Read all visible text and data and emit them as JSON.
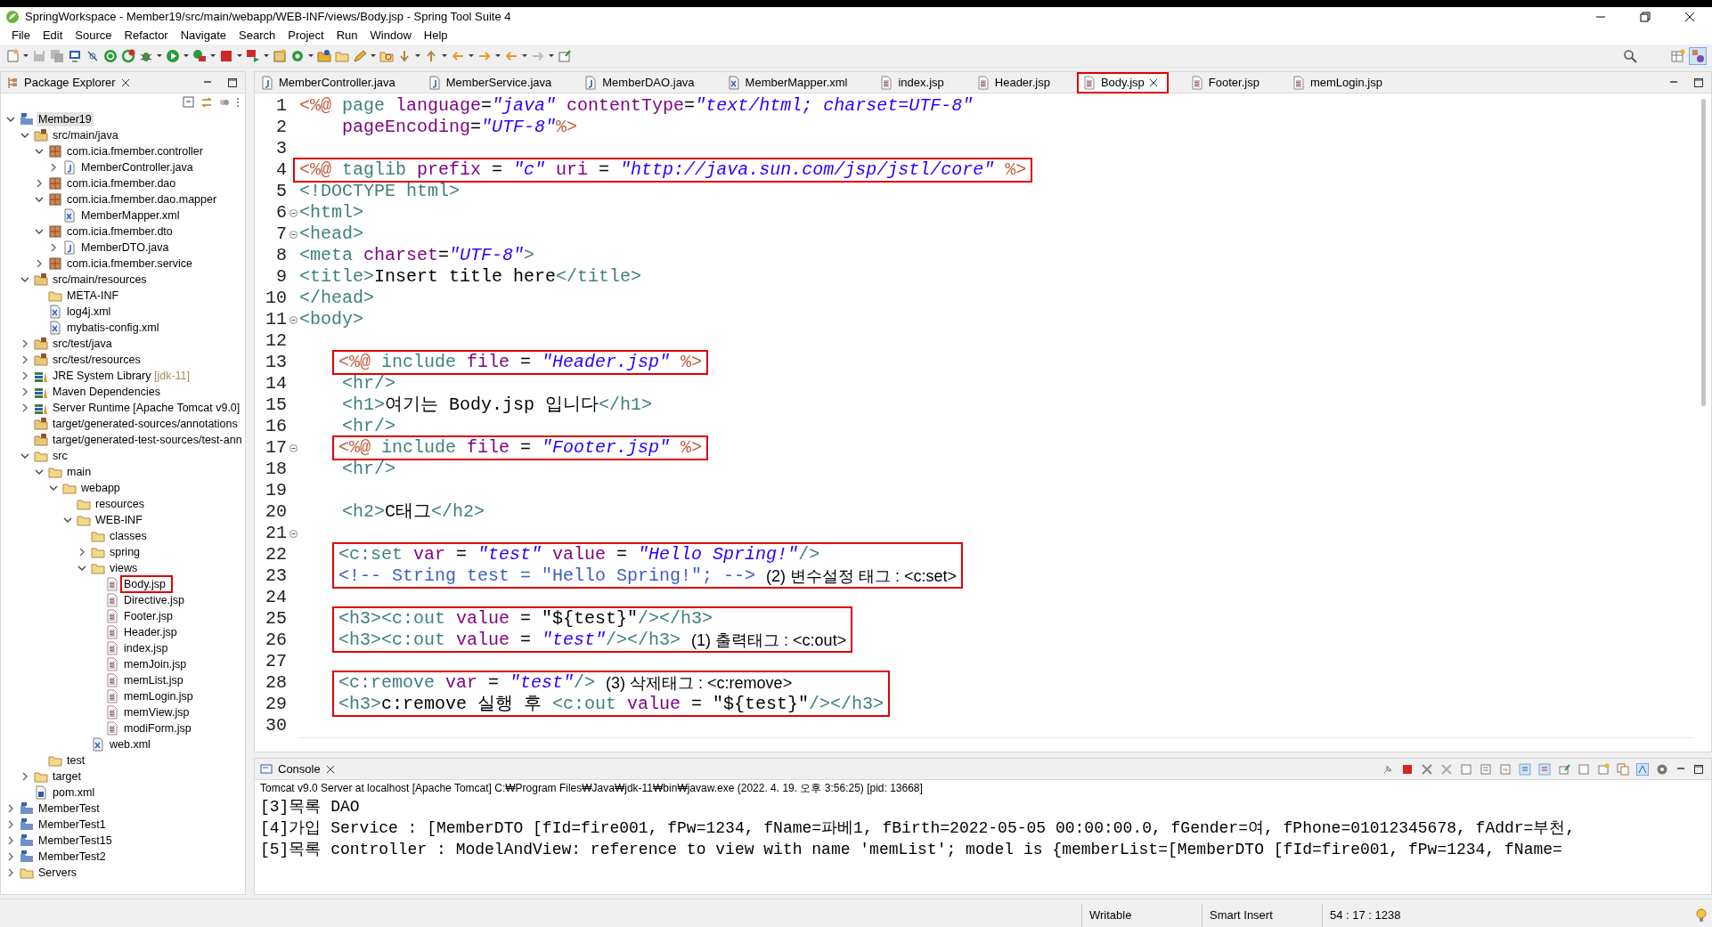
{
  "window": {
    "title": "SpringWorkspace - Member19/src/main/webapp/WEB-INF/views/Body.jsp - Spring Tool Suite 4"
  },
  "menu": [
    "File",
    "Edit",
    "Source",
    "Refactor",
    "Navigate",
    "Search",
    "Project",
    "Run",
    "Window",
    "Help"
  ],
  "package_explorer": {
    "title": "Package Explorer",
    "tree": [
      {
        "label": "Member19",
        "kind": "project",
        "expanded": true,
        "selected": true,
        "annotated": false,
        "children": [
          {
            "label": "src/main/java",
            "kind": "srcfolder",
            "expanded": true,
            "selected": false,
            "annotated": false,
            "children": [
              {
                "label": "com.icia.fmember.controller",
                "kind": "package",
                "expanded": true,
                "selected": false,
                "annotated": false,
                "children": [
                  {
                    "label": "MemberController.java",
                    "kind": "java",
                    "expanded": false,
                    "selected": false,
                    "annotated": false
                  }
                ]
              },
              {
                "label": "com.icia.fmember.dao",
                "kind": "package",
                "expanded": false,
                "selected": false,
                "annotated": false
              },
              {
                "label": "com.icia.fmember.dao.mapper",
                "kind": "package",
                "expanded": true,
                "selected": false,
                "annotated": false,
                "children": [
                  {
                    "label": "MemberMapper.xml",
                    "kind": "xml",
                    "selected": false,
                    "annotated": false
                  }
                ]
              },
              {
                "label": "com.icia.fmember.dto",
                "kind": "package",
                "expanded": true,
                "selected": false,
                "annotated": false,
                "children": [
                  {
                    "label": "MemberDTO.java",
                    "kind": "java",
                    "expanded": false,
                    "selected": false,
                    "annotated": false
                  }
                ]
              },
              {
                "label": "com.icia.fmember.service",
                "kind": "package",
                "expanded": false,
                "selected": false,
                "annotated": false
              }
            ]
          },
          {
            "label": "src/main/resources",
            "kind": "srcfolder",
            "expanded": true,
            "selected": false,
            "annotated": false,
            "children": [
              {
                "label": "META-INF",
                "kind": "folder",
                "selected": false,
                "annotated": false
              },
              {
                "label": "log4j.xml",
                "kind": "xml",
                "selected": false,
                "annotated": false
              },
              {
                "label": "mybatis-config.xml",
                "kind": "xml",
                "selected": false,
                "annotated": false
              }
            ]
          },
          {
            "label": "src/test/java",
            "kind": "srcfolder",
            "expanded": false,
            "selected": false,
            "annotated": false
          },
          {
            "label": "src/test/resources",
            "kind": "srcfolder",
            "expanded": false,
            "selected": false,
            "annotated": false
          },
          {
            "label": "JRE System Library",
            "decoration": "[jdk-11]",
            "kind": "library",
            "expanded": false,
            "selected": false,
            "annotated": false
          },
          {
            "label": "Maven Dependencies",
            "kind": "library",
            "expanded": false,
            "selected": false,
            "annotated": false
          },
          {
            "label": "Server Runtime [Apache Tomcat v9.0]",
            "kind": "library",
            "expanded": false,
            "selected": false,
            "annotated": false
          },
          {
            "label": "target/generated-sources/annotations",
            "kind": "srcfolder",
            "selected": false,
            "annotated": false
          },
          {
            "label": "target/generated-test-sources/test-ann",
            "kind": "srcfolder",
            "selected": false,
            "annotated": false
          },
          {
            "label": "src",
            "kind": "folder",
            "expanded": true,
            "selected": false,
            "annotated": false,
            "children": [
              {
                "label": "main",
                "kind": "folder",
                "expanded": true,
                "selected": false,
                "annotated": false,
                "children": [
                  {
                    "label": "webapp",
                    "kind": "folder",
                    "expanded": true,
                    "selected": false,
                    "annotated": false,
                    "children": [
                      {
                        "label": "resources",
                        "kind": "folder",
                        "selected": false,
                        "annotated": false
                      },
                      {
                        "label": "WEB-INF",
                        "kind": "folder",
                        "expanded": true,
                        "selected": false,
                        "annotated": false,
                        "children": [
                          {
                            "label": "classes",
                            "kind": "folder",
                            "selected": false,
                            "annotated": false
                          },
                          {
                            "label": "spring",
                            "kind": "folder",
                            "expanded": false,
                            "selected": false,
                            "annotated": false
                          },
                          {
                            "label": "views",
                            "kind": "folder",
                            "expanded": true,
                            "selected": false,
                            "annotated": false,
                            "children": [
                              {
                                "label": "Body.jsp",
                                "kind": "jsp",
                                "selected": false,
                                "annotated": true
                              },
                              {
                                "label": "Directive.jsp",
                                "kind": "jsp",
                                "selected": false,
                                "annotated": false
                              },
                              {
                                "label": "Footer.jsp",
                                "kind": "jsp",
                                "selected": false,
                                "annotated": false
                              },
                              {
                                "label": "Header.jsp",
                                "kind": "jsp",
                                "selected": false,
                                "annotated": false
                              },
                              {
                                "label": "index.jsp",
                                "kind": "jsp",
                                "selected": false,
                                "annotated": false
                              },
                              {
                                "label": "memJoin.jsp",
                                "kind": "jsp",
                                "selected": false,
                                "annotated": false
                              },
                              {
                                "label": "memList.jsp",
                                "kind": "jsp",
                                "selected": false,
                                "annotated": false
                              },
                              {
                                "label": "memLogin.jsp",
                                "kind": "jsp",
                                "selected": false,
                                "annotated": false
                              },
                              {
                                "label": "memView.jsp",
                                "kind": "jsp",
                                "selected": false,
                                "annotated": false
                              },
                              {
                                "label": "modiForm.jsp",
                                "kind": "jsp",
                                "selected": false,
                                "annotated": false
                              }
                            ]
                          },
                          {
                            "label": "web.xml",
                            "kind": "xml",
                            "selected": false,
                            "annotated": false
                          }
                        ]
                      }
                    ]
                  }
                ]
              },
              {
                "label": "test",
                "kind": "folder",
                "selected": false,
                "annotated": false
              }
            ]
          },
          {
            "label": "target",
            "kind": "folder",
            "expanded": false,
            "selected": false,
            "annotated": false
          },
          {
            "label": "pom.xml",
            "kind": "pom",
            "selected": false,
            "annotated": false
          }
        ]
      },
      {
        "label": "MemberTest",
        "kind": "project",
        "expanded": false,
        "selected": false,
        "annotated": false
      },
      {
        "label": "MemberTest1",
        "kind": "project",
        "expanded": false,
        "selected": false,
        "annotated": false
      },
      {
        "label": "MemberTest15",
        "kind": "project",
        "expanded": false,
        "selected": false,
        "annotated": false
      },
      {
        "label": "MemberTest2",
        "kind": "project",
        "expanded": false,
        "selected": false,
        "annotated": false
      },
      {
        "label": "Servers",
        "kind": "folder",
        "expanded": false,
        "selected": false,
        "annotated": false
      }
    ]
  },
  "editor": {
    "tabs": [
      {
        "label": "MemberController.java",
        "kind": "java",
        "selected": false,
        "annotated": false
      },
      {
        "label": "MemberService.java",
        "kind": "java",
        "selected": false,
        "annotated": false
      },
      {
        "label": "MemberDAO.java",
        "kind": "java",
        "selected": false,
        "annotated": false
      },
      {
        "label": "MemberMapper.xml",
        "kind": "xml",
        "selected": false,
        "annotated": false
      },
      {
        "label": "index.jsp",
        "kind": "jsp",
        "selected": false,
        "annotated": false
      },
      {
        "label": "Header.jsp",
        "kind": "jsp",
        "selected": false,
        "annotated": false
      },
      {
        "label": "Body.jsp",
        "kind": "jsp",
        "selected": true,
        "annotated": true
      },
      {
        "label": "Footer.jsp",
        "kind": "jsp",
        "selected": false,
        "annotated": false
      },
      {
        "label": "memLogin.jsp",
        "kind": "jsp",
        "selected": false,
        "annotated": false
      }
    ],
    "blocks": [
      {
        "kind": "line",
        "num": "1",
        "foldable": false,
        "tokens": [
          {
            "kind": "d",
            "t": "<%@"
          },
          {
            "kind": "tg",
            "t": " page "
          },
          {
            "kind": "at",
            "t": "language"
          },
          {
            "kind": "tx",
            "t": "="
          },
          {
            "kind": "st",
            "t": "\"java\""
          },
          {
            "kind": "at",
            "t": " contentType"
          },
          {
            "kind": "tx",
            "t": "="
          },
          {
            "kind": "st",
            "t": "\"text/html; charset=UTF-8\""
          }
        ]
      },
      {
        "kind": "line",
        "num": "2",
        "foldable": false,
        "tokens": [
          {
            "kind": "at",
            "t": "    pageEncoding"
          },
          {
            "kind": "tx",
            "t": "="
          },
          {
            "kind": "st",
            "t": "\"UTF-8\""
          },
          {
            "kind": "d",
            "t": "%>"
          }
        ]
      },
      {
        "kind": "line",
        "num": "3",
        "foldable": false
      },
      {
        "kind": "boxed",
        "indented": false,
        "lines": [
          {
            "num": "4",
            "foldable": false,
            "tokens": [
              {
                "kind": "d",
                "t": "<%@"
              },
              {
                "kind": "tg",
                "t": " taglib "
              },
              {
                "kind": "at",
                "t": "prefix"
              },
              {
                "kind": "tx",
                "t": " = "
              },
              {
                "kind": "st",
                "t": "\"c\""
              },
              {
                "kind": "at",
                "t": " uri"
              },
              {
                "kind": "tx",
                "t": " = "
              },
              {
                "kind": "st",
                "t": "\"http://java.sun.com/jsp/jstl/core\""
              },
              {
                "kind": "d",
                "t": " %>"
              }
            ]
          }
        ]
      },
      {
        "kind": "line",
        "num": "5",
        "foldable": false,
        "tokens": [
          {
            "kind": "tg",
            "t": "<!DOCTYPE html>"
          }
        ]
      },
      {
        "kind": "line",
        "num": "6",
        "foldable": true,
        "tokens": [
          {
            "kind": "tg",
            "t": "<html>"
          }
        ]
      },
      {
        "kind": "line",
        "num": "7",
        "foldable": true,
        "tokens": [
          {
            "kind": "tg",
            "t": "<head>"
          }
        ]
      },
      {
        "kind": "line",
        "num": "8",
        "foldable": false,
        "tokens": [
          {
            "kind": "tg",
            "t": "<meta "
          },
          {
            "kind": "at",
            "t": "charset"
          },
          {
            "kind": "tx",
            "t": "="
          },
          {
            "kind": "st",
            "t": "\"UTF-8\""
          },
          {
            "kind": "tg",
            "t": ">"
          }
        ]
      },
      {
        "kind": "line",
        "num": "9",
        "foldable": false,
        "tokens": [
          {
            "kind": "tg",
            "t": "<title>"
          },
          {
            "kind": "tx",
            "t": "Insert title here"
          },
          {
            "kind": "tg",
            "t": "</title>"
          }
        ]
      },
      {
        "kind": "line",
        "num": "10",
        "foldable": false,
        "tokens": [
          {
            "kind": "tg",
            "t": "</head>"
          }
        ]
      },
      {
        "kind": "line",
        "num": "11",
        "foldable": true,
        "tokens": [
          {
            "kind": "tg",
            "t": "<body>"
          }
        ]
      },
      {
        "kind": "line",
        "num": "12",
        "foldable": false
      },
      {
        "kind": "boxed",
        "indented": true,
        "lines": [
          {
            "num": "13",
            "foldable": false,
            "tokens": [
              {
                "kind": "d",
                "t": "<%@"
              },
              {
                "kind": "tg",
                "t": " include "
              },
              {
                "kind": "at",
                "t": "file"
              },
              {
                "kind": "tx",
                "t": " = "
              },
              {
                "kind": "st",
                "t": "\"Header.jsp\""
              },
              {
                "kind": "d",
                "t": " %>"
              }
            ]
          }
        ]
      },
      {
        "kind": "line",
        "num": "14",
        "foldable": false,
        "tokens": [
          {
            "kind": "tg",
            "t": "    <hr/>"
          }
        ]
      },
      {
        "kind": "line",
        "num": "15",
        "foldable": false,
        "tokens": [
          {
            "kind": "tg",
            "t": "    <h1>"
          },
          {
            "kind": "tx",
            "t": "여기는 Body.jsp 입니다"
          },
          {
            "kind": "tg",
            "t": "</h1>"
          }
        ]
      },
      {
        "kind": "line",
        "num": "16",
        "foldable": false,
        "tokens": [
          {
            "kind": "tg",
            "t": "    <hr/>"
          }
        ]
      },
      {
        "kind": "boxed",
        "indented": true,
        "lines": [
          {
            "num": "17",
            "foldable": true,
            "tokens": [
              {
                "kind": "d",
                "t": "<%@"
              },
              {
                "kind": "tg",
                "t": " include "
              },
              {
                "kind": "at",
                "t": "file"
              },
              {
                "kind": "tx",
                "t": " = "
              },
              {
                "kind": "st",
                "t": "\"Footer.jsp\""
              },
              {
                "kind": "d",
                "t": " %>"
              }
            ]
          }
        ]
      },
      {
        "kind": "line",
        "num": "18",
        "foldable": false,
        "tokens": [
          {
            "kind": "tg",
            "t": "    <hr/>"
          }
        ]
      },
      {
        "kind": "line",
        "num": "19",
        "foldable": false
      },
      {
        "kind": "line",
        "num": "20",
        "foldable": false,
        "tokens": [
          {
            "kind": "tg",
            "t": "    <h2>"
          },
          {
            "kind": "tx",
            "t": "C태그"
          },
          {
            "kind": "tg",
            "t": "</h2>"
          }
        ]
      },
      {
        "kind": "line",
        "num": "21",
        "foldable": true
      },
      {
        "kind": "boxed",
        "indented": true,
        "lines": [
          {
            "num": "22",
            "foldable": false,
            "tokens": [
              {
                "kind": "tg",
                "t": "<c:set "
              },
              {
                "kind": "at",
                "t": "var"
              },
              {
                "kind": "tx",
                "t": " = "
              },
              {
                "kind": "st",
                "t": "\"test\""
              },
              {
                "kind": "at",
                "t": " value"
              },
              {
                "kind": "tx",
                "t": " = "
              },
              {
                "kind": "st",
                "t": "\"Hello Spring!\""
              },
              {
                "kind": "tg",
                "t": "/>"
              }
            ]
          },
          {
            "num": "23",
            "foldable": false,
            "tokens": [
              {
                "kind": "cm",
                "t": "<!-- String test = \"Hello Spring!\"; -->"
              }
            ],
            "note": "(2) 변수설정 태그 : <c:set>"
          }
        ]
      },
      {
        "kind": "line",
        "num": "24",
        "foldable": false
      },
      {
        "kind": "boxed",
        "indented": true,
        "lines": [
          {
            "num": "25",
            "foldable": false,
            "tokens": [
              {
                "kind": "tg",
                "t": "<h3><c:out "
              },
              {
                "kind": "at",
                "t": "value"
              },
              {
                "kind": "tx",
                "t": " = \"${test}\""
              },
              {
                "kind": "tg",
                "t": "/></h3>"
              }
            ]
          },
          {
            "num": "26",
            "foldable": false,
            "tokens": [
              {
                "kind": "tg",
                "t": "<h3><c:out "
              },
              {
                "kind": "at",
                "t": "value"
              },
              {
                "kind": "tx",
                "t": " = "
              },
              {
                "kind": "st",
                "t": "\"test\""
              },
              {
                "kind": "tg",
                "t": "/></h3>"
              }
            ],
            "note": "(1) 출력태그 : <c:out>"
          }
        ]
      },
      {
        "kind": "line",
        "num": "27",
        "foldable": false
      },
      {
        "kind": "boxed",
        "indented": true,
        "lines": [
          {
            "num": "28",
            "foldable": false,
            "tokens": [
              {
                "kind": "tg",
                "t": "<c:remove "
              },
              {
                "kind": "at",
                "t": "var"
              },
              {
                "kind": "tx",
                "t": " = "
              },
              {
                "kind": "st",
                "t": "\"test\""
              },
              {
                "kind": "tg",
                "t": "/>"
              }
            ],
            "note": "(3) 삭제태그 : <c:remove>"
          },
          {
            "num": "29",
            "foldable": false,
            "tokens": [
              {
                "kind": "tg",
                "t": "<h3>"
              },
              {
                "kind": "tx",
                "t": "c:remove 실행 후 "
              },
              {
                "kind": "tg",
                "t": "<c:out "
              },
              {
                "kind": "at",
                "t": "value"
              },
              {
                "kind": "tx",
                "t": " = \"${test}\""
              },
              {
                "kind": "tg",
                "t": "/></h3>"
              }
            ]
          }
        ]
      },
      {
        "kind": "line",
        "num": "30",
        "foldable": false
      }
    ]
  },
  "console": {
    "title": "Console",
    "header": "Tomcat v9.0 Server at localhost [Apache Tomcat] C:₩Program Files₩Java₩jdk-11₩bin₩javaw.exe  (2022. 4. 19. 오후 3:56:25) [pid: 13668]",
    "lines": [
      "[3]목록 DAO",
      "[4]가입 Service : [MemberDTO [fId=fire001, fPw=1234, fName=파베1, fBirth=2022-05-05 00:00:00.0, fGender=여, fPhone=01012345678, fAddr=부천,",
      "[5]목록 controller : ModelAndView: reference to view with name 'memList'; model is {memberList=[MemberDTO [fId=fire001, fPw=1234, fName="
    ]
  },
  "status_bar": [
    "Writable",
    "Smart Insert",
    "54 : 17 : 1238"
  ]
}
